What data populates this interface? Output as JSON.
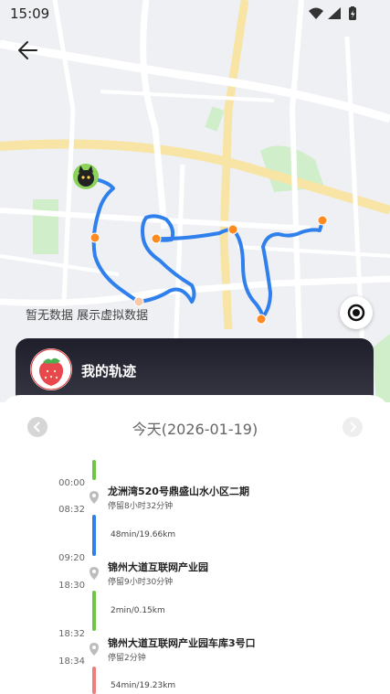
{
  "status_bar": {
    "time": "15:09"
  },
  "map": {
    "no_data_text": "暂无数据 展示虚拟数据",
    "route_color": "#2f80ed",
    "point_color": "#ff8a1f"
  },
  "card": {
    "title": "我的轨迹"
  },
  "date_nav": {
    "title": "今天(2026-01-19)"
  },
  "timeline": {
    "stops": [
      {
        "arrive": "00:00",
        "leave": "08:32",
        "place": "龙洲湾520号鼎盛山水小区二期",
        "stay": "停留8小时32分钟"
      },
      {
        "arrive": "09:20",
        "leave": "18:30",
        "place": "锦州大道互联网产业园",
        "stay": "停留9小时30分钟"
      },
      {
        "arrive": "18:32",
        "leave": "18:34",
        "place": "锦州大道互联网产业园车库3号口",
        "stay": "停留2分钟"
      }
    ],
    "moves": [
      {
        "text": "48min/19.66km",
        "color": "#2f80ed"
      },
      {
        "text": "2min/0.15km",
        "color": "#6cc644"
      },
      {
        "text": "54min/19.23km",
        "color": "#f07d7d"
      }
    ],
    "first_segment_color": "#6cc644"
  }
}
